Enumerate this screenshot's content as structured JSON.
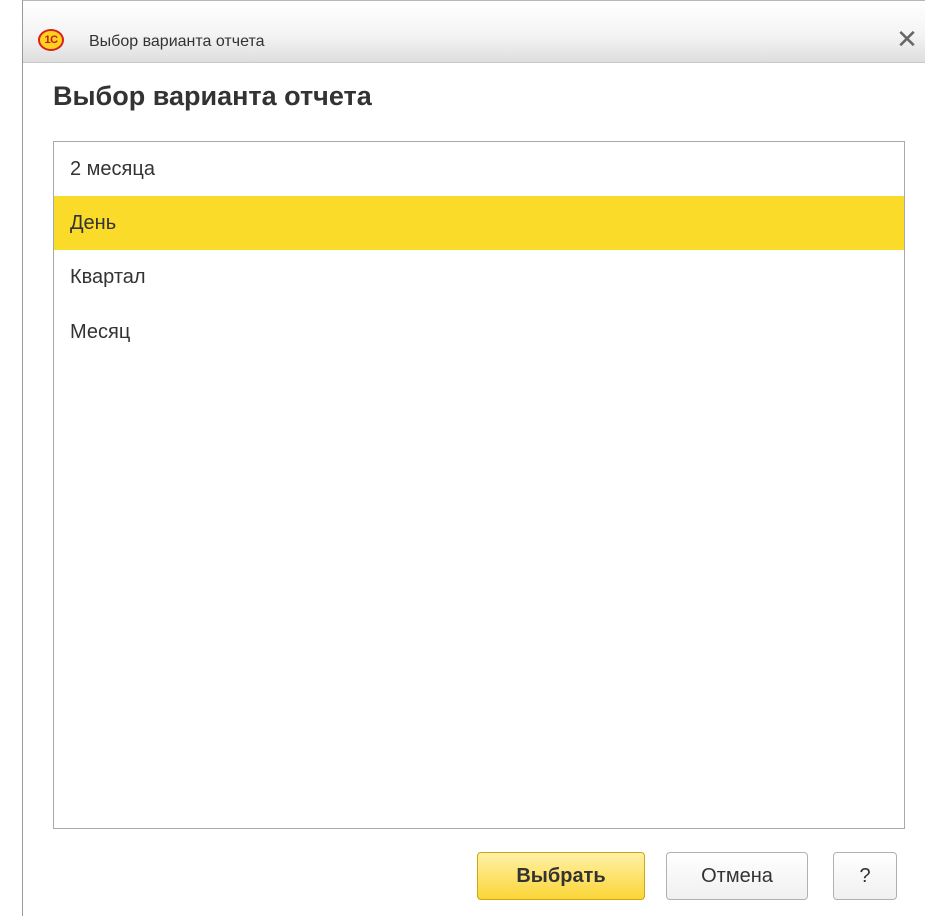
{
  "window": {
    "title": "Выбор варианта отчета",
    "logo_text": "1С"
  },
  "heading": "Выбор варианта отчета",
  "list": {
    "items": [
      {
        "label": "2 месяца",
        "selected": false
      },
      {
        "label": "День",
        "selected": true
      },
      {
        "label": "Квартал",
        "selected": false
      },
      {
        "label": "Месяц",
        "selected": false
      }
    ]
  },
  "buttons": {
    "select": "Выбрать",
    "cancel": "Отмена",
    "help": "?"
  },
  "colors": {
    "selection": "#fbdb29",
    "primary_button": "#fbd536"
  }
}
